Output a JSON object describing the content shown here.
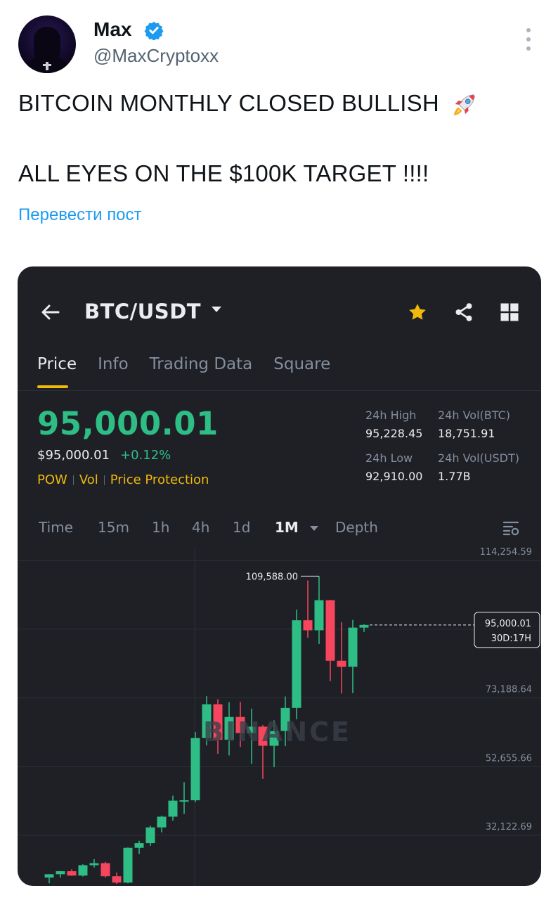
{
  "post": {
    "author_name": "Max",
    "author_handle": "@MaxCryptoxx",
    "line1": "BITCOIN MONTHLY CLOSED BULLISH",
    "line2": "ALL EYES ON THE $100K TARGET !!!!",
    "translate_label": "Перевести пост",
    "icons": [
      "verified-badge-icon",
      "more-options-icon",
      "rocket-emoji"
    ],
    "colors": {
      "link": "#1d9bf0",
      "verified": "#1d9bf0",
      "handle": "#536471"
    }
  },
  "app": {
    "pair": "BTC/USDT",
    "tabs": [
      "Price",
      "Info",
      "Trading Data",
      "Square"
    ],
    "active_tab": "Price",
    "price": "95,000.01",
    "price_usd": "$95,000.01",
    "change": "+0.12%",
    "badges": [
      "POW",
      "Vol",
      "Price Protection"
    ],
    "stats": {
      "high_label": "24h High",
      "high": "95,228.45",
      "volbtc_label": "24h Vol(BTC)",
      "volbtc": "18,751.91",
      "low_label": "24h Low",
      "low": "92,910.00",
      "volusdt_label": "24h Vol(USDT)",
      "volusdt": "1.77B"
    },
    "timeframes": [
      "Time",
      "15m",
      "1h",
      "4h",
      "1d",
      "1M",
      "Depth"
    ],
    "active_timeframe": "1M",
    "watermark": "BINANCE",
    "icons": [
      "back-arrow-icon",
      "caret-down-icon",
      "star-icon",
      "share-icon",
      "grid-icon",
      "chart-settings-icon"
    ],
    "colors": {
      "up": "#2ebd85",
      "down": "#f6465d",
      "accent": "#f0b90b",
      "bg": "#1e2026"
    }
  },
  "chart_data": {
    "type": "candlestick",
    "y_axis_labels": [
      "114,254.59",
      "73,188.64",
      "52,655.66",
      "32,122.69"
    ],
    "grid_value_lines": [
      114254.59,
      93721.62,
      73188.64,
      52655.66,
      32122.69
    ],
    "ylim": [
      17000,
      118500
    ],
    "max_annotation": "109,588.00",
    "max_value": 109588.0,
    "last_price_label": "95,000.01",
    "countdown_label": "30D:17H",
    "last_price": 95000.01,
    "candles": [
      {
        "o": 19500,
        "h": 20500,
        "l": 17800,
        "c": 20500
      },
      {
        "o": 20500,
        "h": 21500,
        "l": 19500,
        "c": 21400
      },
      {
        "o": 21400,
        "h": 22000,
        "l": 20000,
        "c": 20100
      },
      {
        "o": 20100,
        "h": 23500,
        "l": 19800,
        "c": 23200
      },
      {
        "o": 23200,
        "h": 25000,
        "l": 22500,
        "c": 23800
      },
      {
        "o": 23800,
        "h": 24200,
        "l": 19500,
        "c": 19900
      },
      {
        "o": 19900,
        "h": 21000,
        "l": 17600,
        "c": 18000
      },
      {
        "o": 18000,
        "h": 28500,
        "l": 17800,
        "c": 28400
      },
      {
        "o": 28400,
        "h": 30500,
        "l": 26500,
        "c": 29800
      },
      {
        "o": 29800,
        "h": 35000,
        "l": 29000,
        "c": 34500
      },
      {
        "o": 34500,
        "h": 38000,
        "l": 33000,
        "c": 37700
      },
      {
        "o": 37700,
        "h": 44000,
        "l": 36500,
        "c": 42500
      },
      {
        "o": 42500,
        "h": 48000,
        "l": 38500,
        "c": 42600
      },
      {
        "o": 42600,
        "h": 63000,
        "l": 42000,
        "c": 61200
      },
      {
        "o": 61200,
        "h": 73700,
        "l": 59000,
        "c": 71300
      },
      {
        "o": 71300,
        "h": 72800,
        "l": 56500,
        "c": 60700
      },
      {
        "o": 60700,
        "h": 71900,
        "l": 56000,
        "c": 67500
      },
      {
        "o": 67500,
        "h": 72000,
        "l": 58500,
        "c": 62700
      },
      {
        "o": 62700,
        "h": 70000,
        "l": 53500,
        "c": 64600
      },
      {
        "o": 64600,
        "h": 65100,
        "l": 49000,
        "c": 58900
      },
      {
        "o": 58900,
        "h": 66500,
        "l": 52500,
        "c": 63300
      },
      {
        "o": 63300,
        "h": 73600,
        "l": 58800,
        "c": 70200
      },
      {
        "o": 70200,
        "h": 99600,
        "l": 66800,
        "c": 96400
      },
      {
        "o": 96400,
        "h": 108300,
        "l": 91200,
        "c": 93400
      },
      {
        "o": 93400,
        "h": 109588,
        "l": 89300,
        "c": 102400
      },
      {
        "o": 102400,
        "h": 102500,
        "l": 78200,
        "c": 84300
      },
      {
        "o": 84300,
        "h": 95800,
        "l": 74500,
        "c": 82500
      },
      {
        "o": 82500,
        "h": 96500,
        "l": 74600,
        "c": 94200
      },
      {
        "o": 94200,
        "h": 95228.45,
        "l": 92910,
        "c": 95000.01
      }
    ]
  }
}
